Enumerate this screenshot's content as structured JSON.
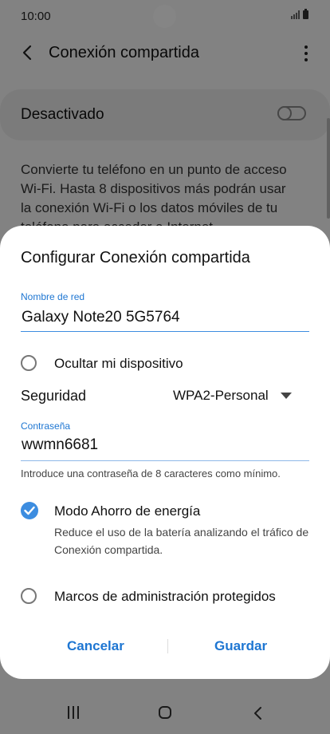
{
  "status_bar": {
    "time": "10:00"
  },
  "app_bar": {
    "title": "Conexión compartida"
  },
  "master_switch": {
    "label": "Desactivado",
    "state": "off"
  },
  "description": "Convierte tu teléfono en un punto de acceso Wi-Fi. Hasta 8 dispositivos más podrán usar la conexión Wi-Fi o los datos móviles de tu teléfono para acceder a Internet.",
  "dialog": {
    "title": "Configurar Conexión compartida",
    "network_name": {
      "label": "Nombre de red",
      "value": "Galaxy Note20 5G5764"
    },
    "hide_device": {
      "label": "Ocultar mi dispositivo",
      "checked": false
    },
    "security": {
      "label": "Seguridad",
      "value": "WPA2-Personal"
    },
    "password": {
      "label": "Contraseña",
      "value": "wwmn6681",
      "hint": "Introduce una contraseña de 8 caracteres como mínimo."
    },
    "power_saving": {
      "label": "Modo Ahorro de energía",
      "description": "Reduce el uso de la batería analizando el tráfico de Conexión compartida.",
      "checked": true
    },
    "protected_frames": {
      "label": "Marcos de administración protegidos",
      "checked": false
    },
    "cancel_label": "Cancelar",
    "save_label": "Guardar"
  },
  "colors": {
    "accent": "#1e76d2",
    "scrim": "rgba(0,0,0,0.48)"
  }
}
